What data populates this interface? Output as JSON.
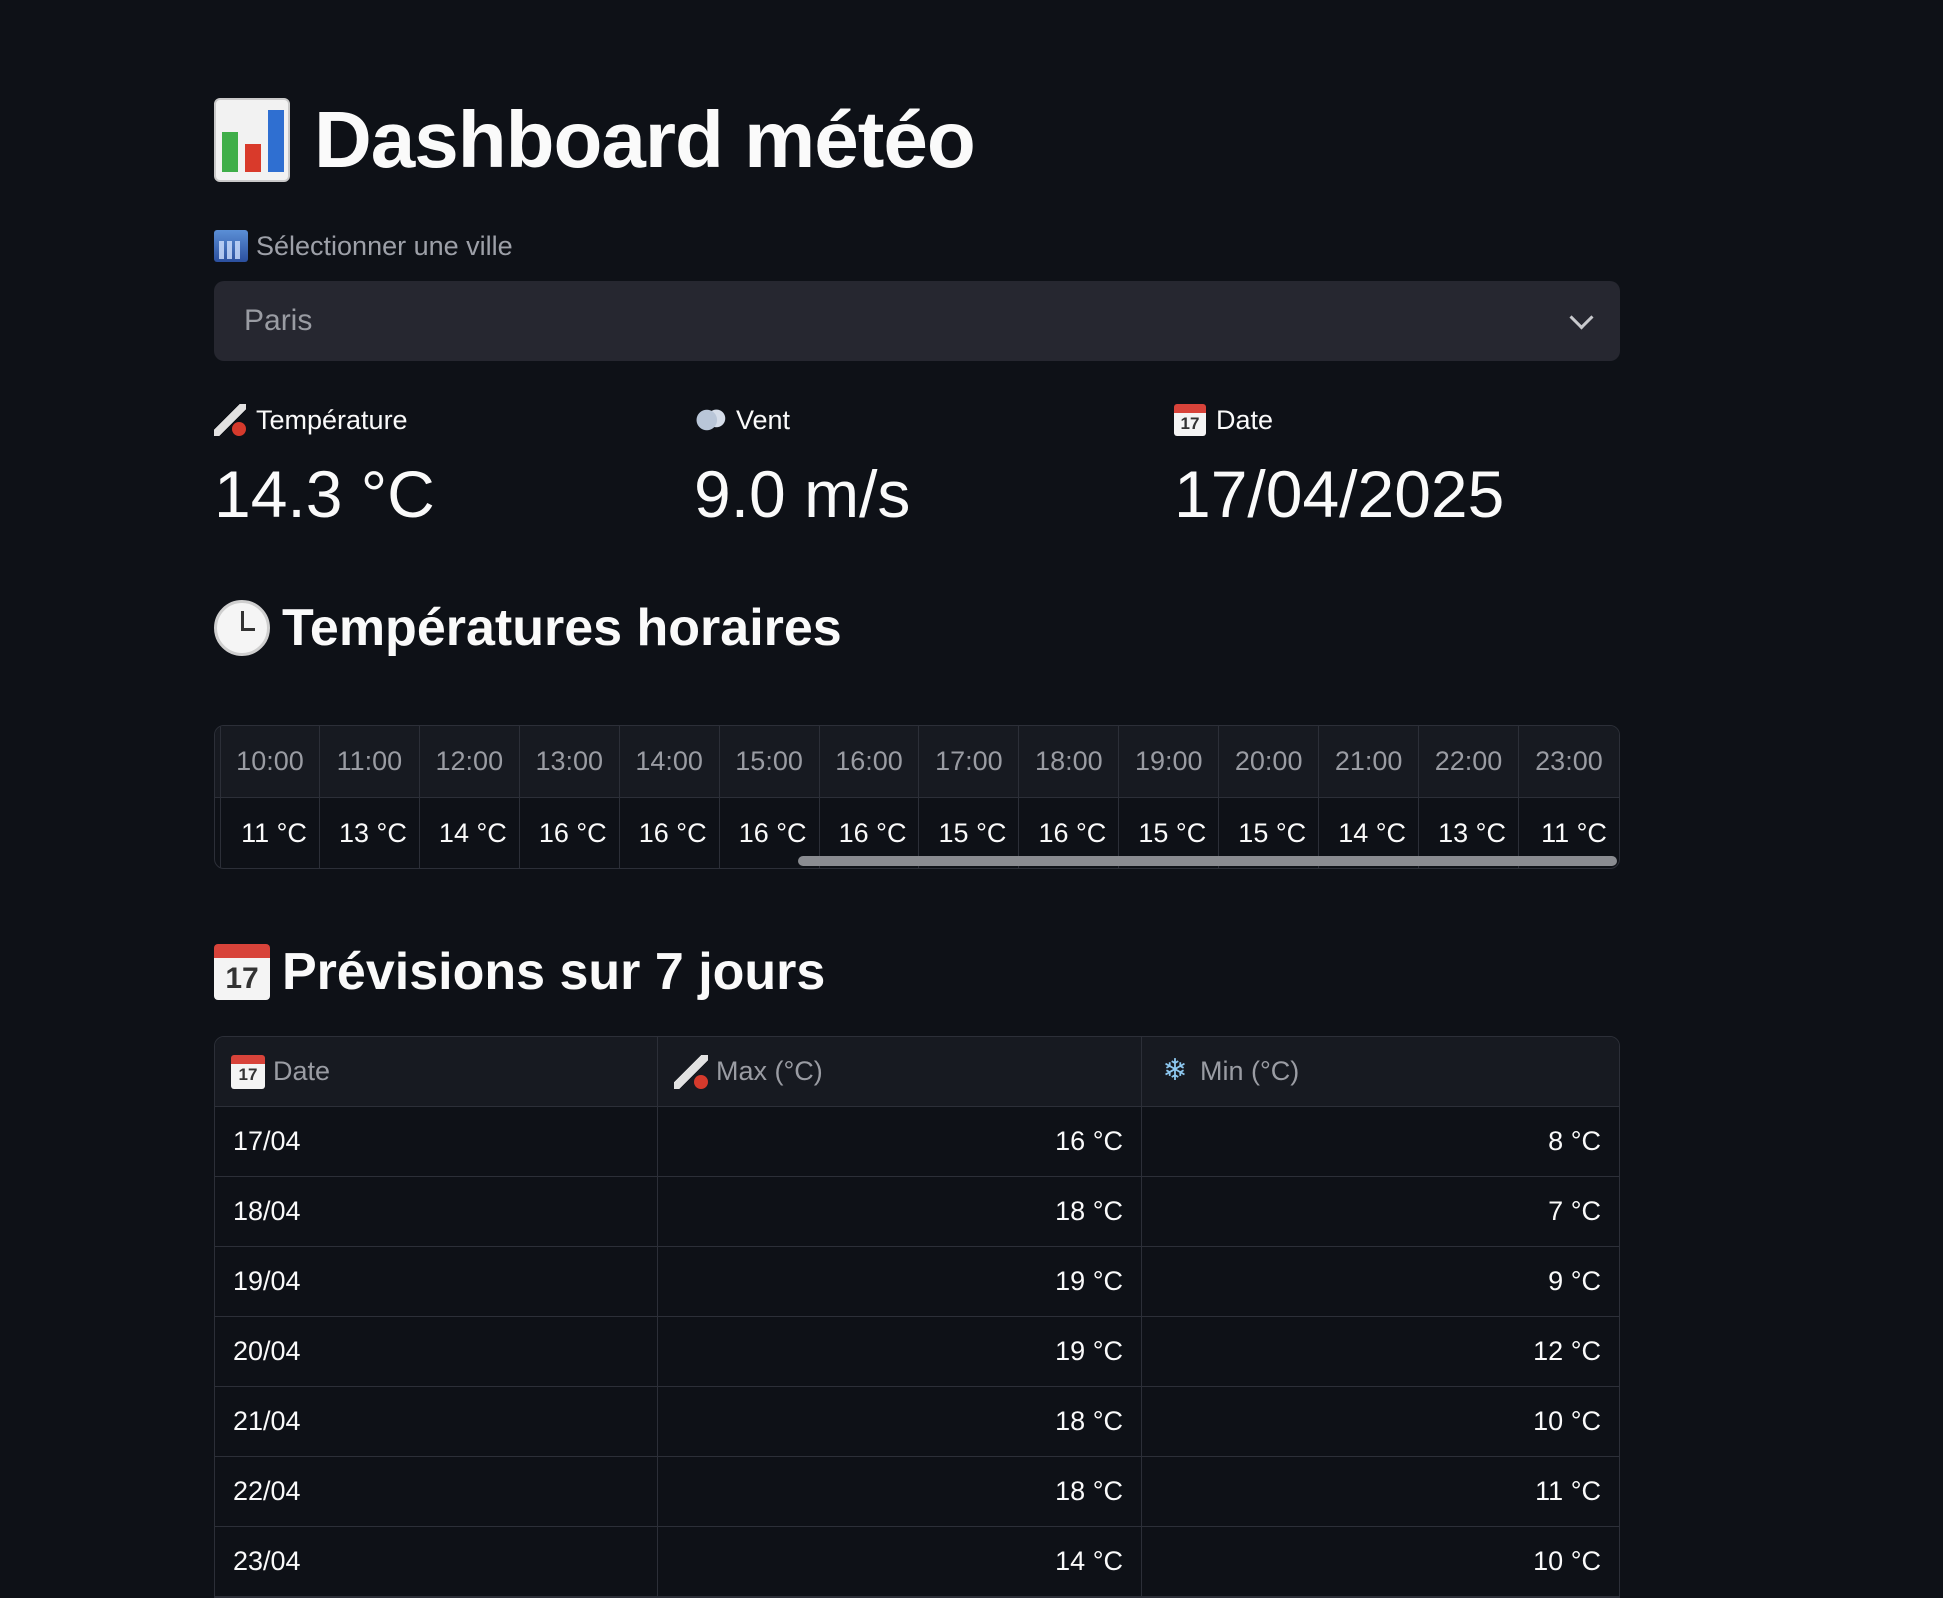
{
  "app": {
    "title": "Dashboard météo"
  },
  "city_select": {
    "label": "Sélectionner une ville",
    "value": "Paris"
  },
  "metrics": [
    {
      "label": "Température",
      "value": "14.3 °C",
      "icon": "thermometer-icon"
    },
    {
      "label": "Vent",
      "value": "9.0 m/s",
      "icon": "wind-icon"
    },
    {
      "label": "Date",
      "value": "17/04/2025",
      "icon": "calendar-icon"
    }
  ],
  "hourly": {
    "title": "Températures horaires",
    "hours": [
      "10:00",
      "11:00",
      "12:00",
      "13:00",
      "14:00",
      "15:00",
      "16:00",
      "17:00",
      "18:00",
      "19:00",
      "20:00",
      "21:00",
      "22:00",
      "23:00"
    ],
    "temps": [
      "11 °C",
      "13 °C",
      "14 °C",
      "16 °C",
      "16 °C",
      "16 °C",
      "16 °C",
      "15 °C",
      "16 °C",
      "15 °C",
      "15 °C",
      "14 °C",
      "13 °C",
      "11 °C"
    ]
  },
  "forecast": {
    "title": "Prévisions sur 7 jours",
    "columns": [
      "Date",
      "Max (°C)",
      "Min (°C)"
    ],
    "rows": [
      {
        "date": "17/04",
        "max": "16 °C",
        "min": "8 °C"
      },
      {
        "date": "18/04",
        "max": "18 °C",
        "min": "7 °C"
      },
      {
        "date": "19/04",
        "max": "19 °C",
        "min": "9 °C"
      },
      {
        "date": "20/04",
        "max": "19 °C",
        "min": "12 °C"
      },
      {
        "date": "21/04",
        "max": "18 °C",
        "min": "10 °C"
      },
      {
        "date": "22/04",
        "max": "18 °C",
        "min": "11 °C"
      },
      {
        "date": "23/04",
        "max": "14 °C",
        "min": "10 °C"
      }
    ]
  },
  "icon_labels": {
    "calendar_day": "17"
  }
}
